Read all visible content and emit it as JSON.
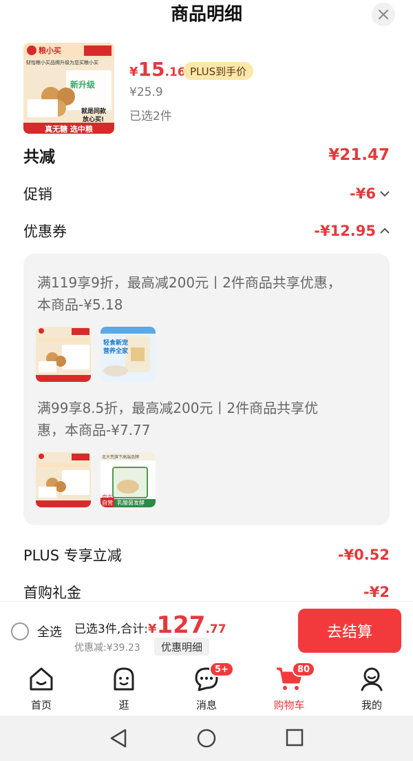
{
  "header": {
    "title": "商品明细"
  },
  "product": {
    "price_yen": "¥",
    "price_int": "15",
    "price_dec": ".16",
    "plus_badge": "PLUS到手价",
    "original_price": "¥25.9",
    "selected_count": "已选2件",
    "thumb_brand": "粮小买",
    "thumb_line": "财怡粮小买品牌升级为您买粮小买",
    "thumb_new": "新升级",
    "thumb_same": "就是同款",
    "thumb_assure": "放心买!",
    "thumb_footer": "真无糖 选中粮"
  },
  "breakdown": {
    "total_label": "共减",
    "total_value": "¥21.47",
    "promo_label": "促销",
    "promo_value": "-¥6",
    "coupon_label": "优惠券",
    "coupon_value": "-¥12.95",
    "plus_label": "PLUS 专享立减",
    "plus_value": "-¥0.52",
    "first_label": "首购礼金",
    "first_value": "-¥2"
  },
  "coupons": [
    {
      "line1": "满119享9折，最高减200元丨2件商品共享优惠，",
      "line2": "本商品-¥5.18"
    },
    {
      "line1": "满99享8.5折，最高减200元丨2件商品共享优",
      "line2": "惠，本商品-¥7.77"
    }
  ],
  "coupon_thumbs": {
    "second_a_line1": "轻食新宠",
    "second_a_line2": "营养全家",
    "second_b_top": "北大荒旗下高端品牌",
    "second_b_jd": "京东",
    "second_b_self": "自营",
    "second_b_tag": "乳酸菌发酵"
  },
  "bottom": {
    "select_all": "全选",
    "summary_text": "已选3件,合计:",
    "total_yen": "¥",
    "total_int": "127",
    "total_dec": ".77",
    "discount": "优惠减:¥39.23",
    "detail_button": "优惠明细",
    "checkout": "去结算"
  },
  "tabs": [
    {
      "label": "首页"
    },
    {
      "label": "逛"
    },
    {
      "label": "消息",
      "badge": "5+"
    },
    {
      "label": "购物车",
      "badge": "80"
    },
    {
      "label": "我的"
    }
  ],
  "colors": {
    "accent": "#e4393c",
    "checkout": "#f23a3c",
    "plus_badge": "#fbe7a9"
  }
}
